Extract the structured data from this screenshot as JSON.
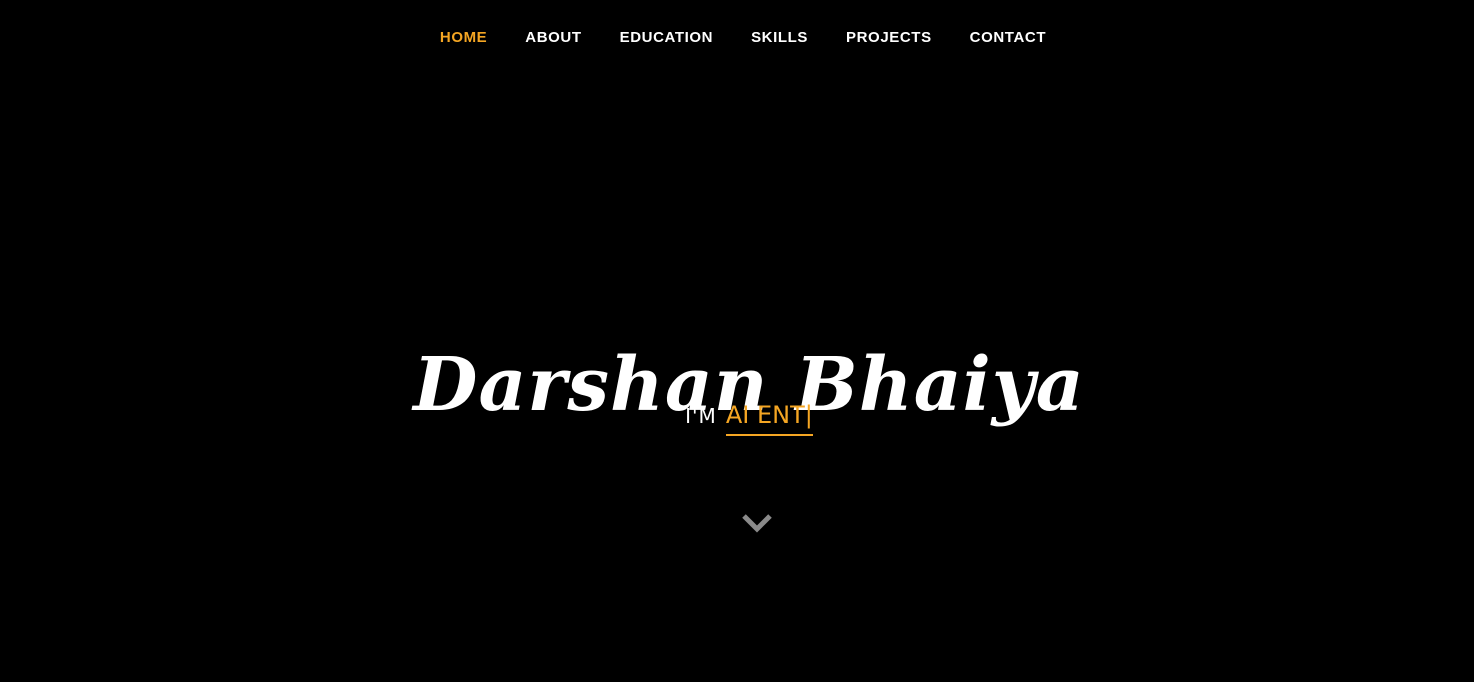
{
  "nav": {
    "items": [
      {
        "label": "HOME",
        "active": true
      },
      {
        "label": "ABOUT",
        "active": false
      },
      {
        "label": "EDUCATION",
        "active": false
      },
      {
        "label": "SKILLS",
        "active": false
      },
      {
        "label": "PROJECTS",
        "active": false
      },
      {
        "label": "CONTACT",
        "active": false
      }
    ]
  },
  "hero": {
    "name": "Darshan Bhaiya",
    "tagline_prefix": "I'M",
    "tagline_typed": "AI ENT|",
    "scroll_icon": "chevron-down-icon"
  },
  "colors": {
    "background": "#000000",
    "accent": "#f5a623",
    "text": "#ffffff",
    "icon": "#8a8a8a"
  }
}
